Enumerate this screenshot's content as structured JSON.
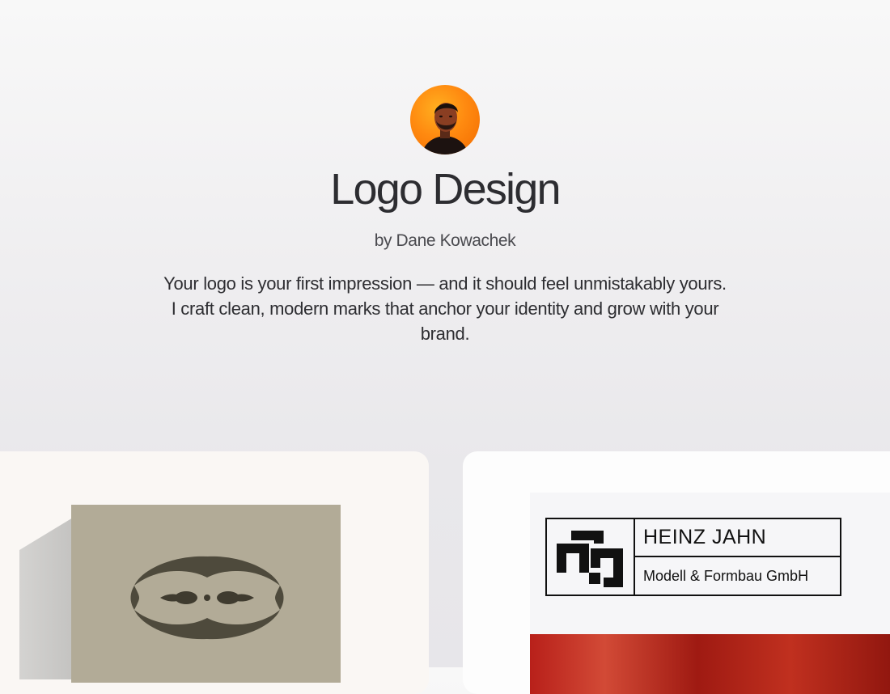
{
  "header": {
    "title": "Logo Design",
    "byline": "by Dane Kowachek",
    "description": "Your logo is your first impression — and it should feel unmistakably yours. I craft clean, modern marks that anchor your identity and grow with your brand."
  },
  "avatar": {
    "icon": "person-portrait",
    "background": "#ff8a10"
  },
  "portfolio": {
    "cards": [
      {
        "name": "Emblem mark",
        "background": "#b2ab97"
      },
      {
        "name": "Heinz Jahn sign",
        "sign_title": "HEINZ JAHN",
        "sign_subtitle": "Modell & Formbau GmbH"
      }
    ]
  }
}
